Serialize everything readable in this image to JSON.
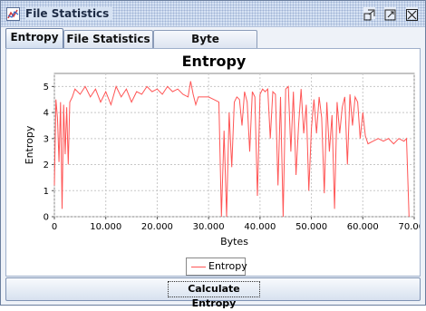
{
  "window": {
    "title": "File Statistics",
    "controls": [
      "restore-icon",
      "maximize-icon",
      "close-icon"
    ]
  },
  "tabs": [
    {
      "label": "Entropy",
      "active": true
    },
    {
      "label": "File Statistics",
      "active": false
    },
    {
      "label": "Byte Distribution",
      "active": false
    }
  ],
  "button": {
    "label": "Calculate Entropy"
  },
  "colors": {
    "series": "#ff5555",
    "grid": "#c8c8c8",
    "accent": "#1c2a44"
  },
  "chart_data": {
    "type": "line",
    "title": "Entropy",
    "xlabel": "Bytes",
    "ylabel": "Entropy",
    "xlim": [
      0,
      70000
    ],
    "ylim": [
      0,
      5.5
    ],
    "xticks": [
      0,
      10000,
      20000,
      30000,
      40000,
      50000,
      60000,
      70000
    ],
    "xtick_labels": [
      "0",
      "10.000",
      "20.000",
      "30.000",
      "40.000",
      "50.000",
      "60.000",
      "70.000"
    ],
    "yticks": [
      0,
      1,
      2,
      3,
      4,
      5
    ],
    "ytick_labels": [
      "0",
      "1",
      "2",
      "3",
      "4",
      "5"
    ],
    "grid": true,
    "legend": "bottom-center",
    "series": [
      {
        "name": "Entropy",
        "x": [
          0,
          300,
          600,
          900,
          1200,
          1500,
          1800,
          2100,
          2400,
          2700,
          3000,
          3500,
          4000,
          5000,
          6000,
          7000,
          8000,
          9000,
          10000,
          11000,
          12000,
          13000,
          14000,
          15000,
          16000,
          17000,
          18000,
          19000,
          20000,
          21000,
          22000,
          23000,
          24000,
          25000,
          26000,
          26500,
          27000,
          27500,
          28000,
          29000,
          30000,
          31000,
          32000,
          32500,
          33000,
          33500,
          34000,
          34500,
          35000,
          35500,
          36000,
          36500,
          37000,
          37500,
          38000,
          38500,
          39000,
          39500,
          40000,
          40500,
          41000,
          41500,
          42000,
          42500,
          43000,
          43500,
          44000,
          44500,
          45000,
          45500,
          46000,
          46500,
          47000,
          47500,
          48000,
          48500,
          49000,
          49500,
          50000,
          50500,
          51000,
          51500,
          52000,
          52500,
          53000,
          53500,
          54000,
          54500,
          55000,
          55500,
          56000,
          56500,
          57000,
          57500,
          58000,
          58500,
          59000,
          59500,
          60000,
          60500,
          61000,
          62000,
          63000,
          64000,
          65000,
          66000,
          67000,
          68000,
          68500,
          69000
        ],
        "y": [
          1.2,
          4.5,
          3.8,
          2.1,
          4.4,
          0.3,
          4.3,
          2.4,
          4.2,
          2.0,
          4.4,
          4.6,
          4.9,
          4.7,
          5.0,
          4.6,
          4.9,
          4.4,
          4.8,
          4.3,
          5.0,
          4.6,
          4.9,
          4.4,
          4.8,
          4.7,
          5.0,
          4.8,
          4.9,
          4.7,
          5.0,
          4.8,
          4.9,
          4.7,
          4.6,
          5.2,
          4.7,
          4.3,
          4.6,
          4.6,
          4.6,
          4.5,
          4.4,
          0.0,
          3.3,
          0.0,
          4.0,
          1.9,
          4.4,
          4.6,
          4.5,
          3.5,
          4.8,
          4.4,
          2.5,
          4.8,
          4.6,
          0.8,
          4.7,
          4.9,
          4.8,
          4.9,
          3.0,
          4.8,
          4.7,
          1.2,
          4.6,
          0.0,
          4.9,
          5.0,
          2.5,
          4.8,
          1.6,
          3.5,
          4.9,
          3.2,
          4.3,
          1.0,
          3.4,
          4.5,
          3.2,
          4.6,
          3.8,
          0.9,
          4.4,
          2.5,
          3.9,
          0.3,
          4.4,
          3.2,
          4.2,
          4.6,
          2.0,
          4.7,
          3.5,
          4.6,
          4.4,
          3.0,
          4.0,
          3.1,
          2.8,
          2.9,
          3.0,
          2.9,
          3.0,
          2.8,
          3.0,
          2.9,
          3.0,
          0.0
        ]
      }
    ]
  }
}
